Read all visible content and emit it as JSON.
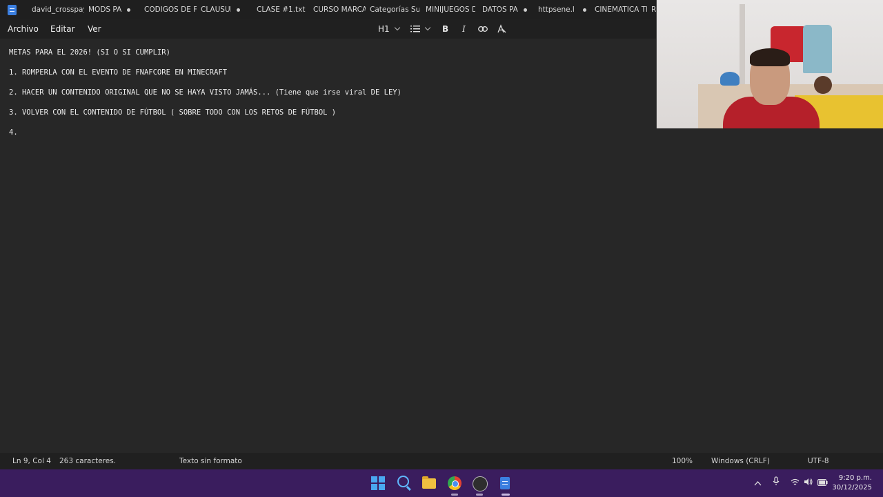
{
  "tabs": [
    {
      "label": "david_crosspay_",
      "dot": false
    },
    {
      "label": "MODS PA",
      "dot": true
    },
    {
      "label": "CODIGOS DE FO",
      "dot": false
    },
    {
      "label": "CLAUSULA",
      "dot": true
    },
    {
      "label": "CLASE #1.txt",
      "dot": false
    },
    {
      "label": "CURSO MARCA",
      "dot": false
    },
    {
      "label": "Categorías Supe",
      "dot": false
    },
    {
      "label": "MINIJUEGOS DE",
      "dot": false
    },
    {
      "label": "DATOS PA",
      "dot": true
    },
    {
      "label": "httpsene.l",
      "dot": true
    },
    {
      "label": "CINEMATICA TR",
      "dot": false
    },
    {
      "label": "R",
      "dot": false
    }
  ],
  "menu": {
    "archivo": "Archivo",
    "editar": "Editar",
    "ver": "Ver"
  },
  "toolbar": {
    "heading": "H1",
    "bold": "B",
    "italic": "I"
  },
  "editor": {
    "lines": [
      "METAS PARA EL 2026! (SI O SI CUMPLIR)",
      "1. ROMPERLA CON EL EVENTO DE FNAFCORE EN MINECRAFT",
      "2. HACER UN CONTENIDO ORIGINAL QUE NO SE HAYA VISTO JAMÁS... (Tiene que irse viral DE LEY)",
      "3. VOLVER CON EL CONTENIDO DE FÚTBOL ( SOBRE TODO CON LOS RETOS DE FÚTBOL )",
      "4."
    ]
  },
  "status": {
    "position": "Ln 9, Col 4",
    "chars": "263 caracteres.",
    "format": "Texto sin formato",
    "zoom": "100%",
    "line_ending": "Windows (CRLF)",
    "encoding": "UTF-8"
  },
  "clock": {
    "time": "9:20 p.m.",
    "date": "30/12/2025"
  },
  "icons": [
    "notepad-icon",
    "windows-start-icon",
    "search-icon",
    "file-explorer-icon",
    "chrome-icon",
    "obs-icon",
    "notepad-taskbar-icon",
    "chevron-up-icon",
    "microphone-icon",
    "speaker-icon",
    "wifi-icon",
    "battery-icon"
  ]
}
